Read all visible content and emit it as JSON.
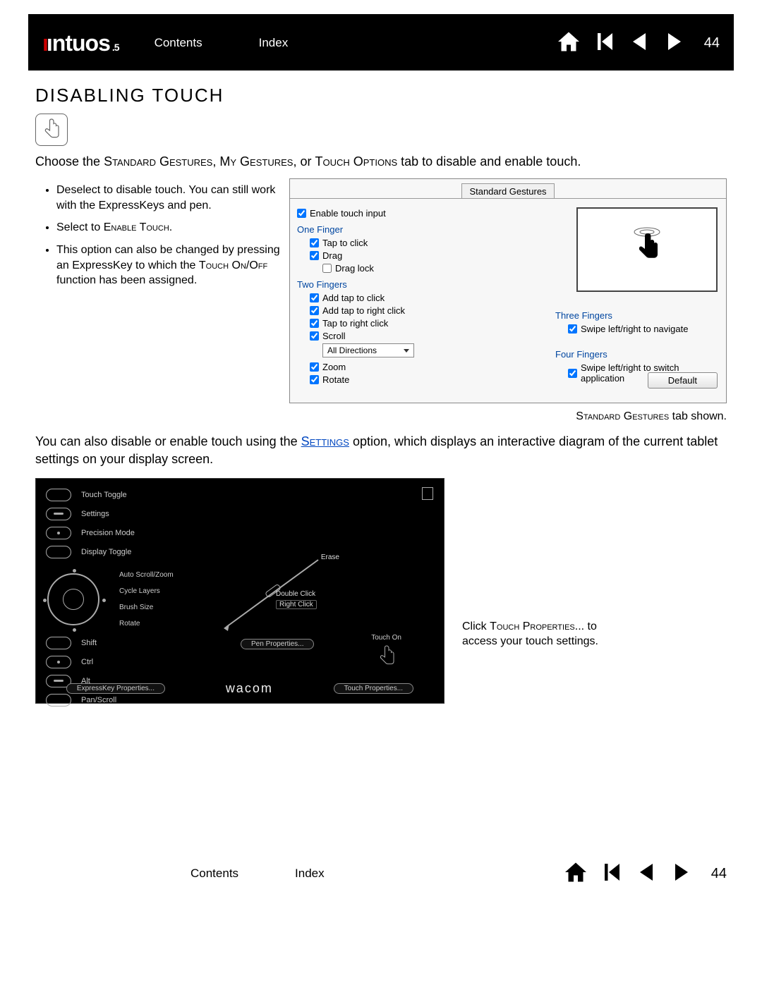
{
  "header": {
    "logo_main": "ıntuos",
    "logo_sub": "5",
    "contents": "Contents",
    "index": "Index",
    "page_number": "44"
  },
  "title": "DISABLING TOUCH",
  "intro": {
    "prefix": "Choose the ",
    "sg": "Standard Gestures",
    "mg": "My Gestures",
    "to": "Touch Options",
    "suffix": " tab to disable and enable touch."
  },
  "bullets": {
    "b1": "Deselect to disable touch.  You can still work with the ExpressKeys and pen.",
    "b2_prefix": "Select to ",
    "b2_sc": "Enable Touch",
    "b2_suffix": ".",
    "b3_prefix": "This option can also be changed by pressing an ExpressKey to which the ",
    "b3_sc": "Touch On/Off",
    "b3_suffix": " function has been assigned."
  },
  "dialog": {
    "tab": "Standard Gestures",
    "enable_touch": "Enable touch input",
    "one_finger": "One Finger",
    "tap_to_click": "Tap to click",
    "drag": "Drag",
    "drag_lock": "Drag lock",
    "two_fingers": "Two Fingers",
    "add_tap_click": "Add tap to click",
    "add_tap_rclick": "Add tap to right click",
    "tap_rclick": "Tap to right click",
    "scroll": "Scroll",
    "all_directions": "All Directions",
    "zoom": "Zoom",
    "rotate": "Rotate",
    "three_fingers": "Three Fingers",
    "swipe_nav": "Swipe left/right to navigate",
    "four_fingers": "Four Fingers",
    "swipe_app": "Swipe left/right to switch application",
    "default_btn": "Default"
  },
  "caption": {
    "sc": "Standard Gestures",
    "suffix": " tab shown."
  },
  "mid_para": {
    "p1": "You can also disable or enable touch using the ",
    "link": "Settings",
    "p2": " option, which displays an interactive diagram of the current tablet settings on your display screen."
  },
  "settings_panel": {
    "ek": {
      "touch_toggle": "Touch Toggle",
      "settings": "Settings",
      "precision": "Precision Mode",
      "display": "Display Toggle",
      "shift": "Shift",
      "ctrl": "Ctrl",
      "alt": "Alt",
      "panscroll": "Pan/Scroll"
    },
    "ring": {
      "autoscroll": "Auto Scroll/Zoom",
      "cycle": "Cycle Layers",
      "brush": "Brush Size",
      "rotate": "Rotate"
    },
    "pen": {
      "erase": "Erase",
      "dbl": "Double Click",
      "rclick": "Right Click",
      "props": "Pen Properties..."
    },
    "touch_on": "Touch On",
    "ek_props": "ExpressKey Properties...",
    "touch_props": "Touch Properties...",
    "brand": "wacom"
  },
  "side_note": {
    "p1": "Click ",
    "sc": "Touch Properties...",
    "p2": " to access your touch settings."
  },
  "footer": {
    "contents": "Contents",
    "index": "Index",
    "page_number": "44"
  }
}
